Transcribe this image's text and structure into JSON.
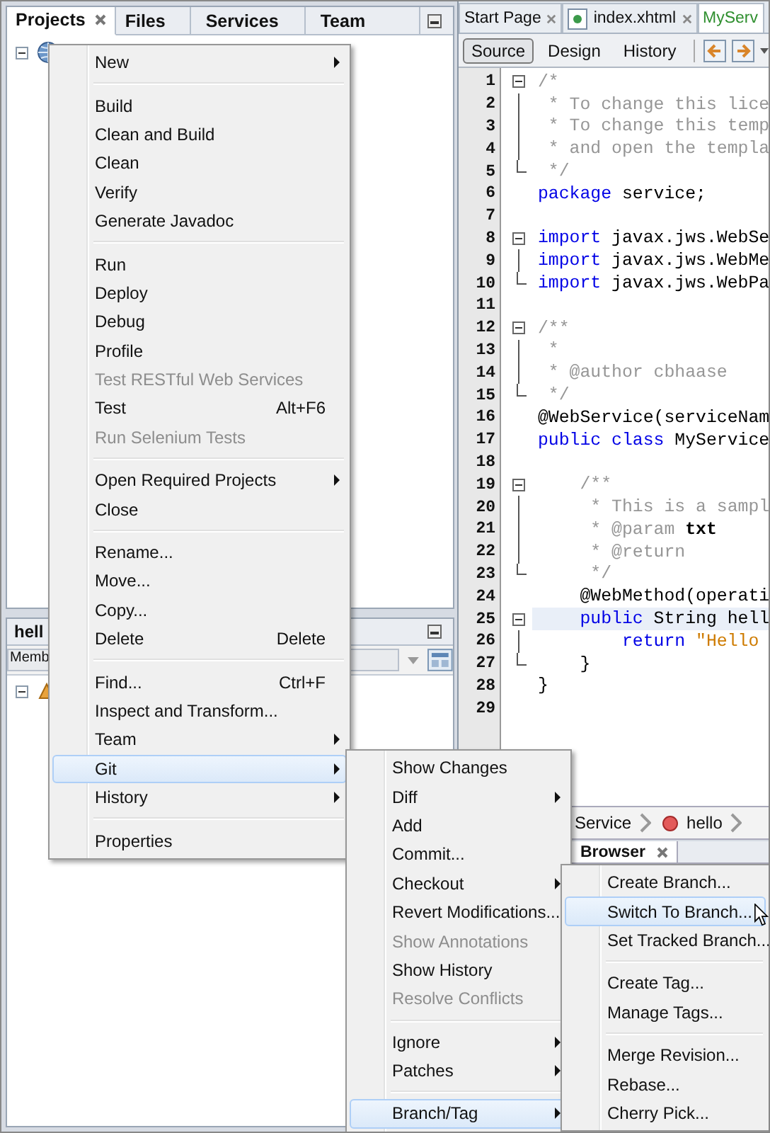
{
  "projects_panel": {
    "tabs": [
      {
        "label": "Projects",
        "selected": true,
        "closable": true
      },
      {
        "label": "Files",
        "selected": false,
        "closable": false
      },
      {
        "label": "Services",
        "selected": false,
        "closable": false
      },
      {
        "label": "Team",
        "selected": false,
        "closable": false
      }
    ],
    "tree_root": {
      "expanded": true
    }
  },
  "navigator_panel": {
    "title": "hell",
    "filter": "Memb",
    "tree_root": {
      "expanded": true
    }
  },
  "editor": {
    "tabs": [
      {
        "label": "Start Page",
        "selected": false,
        "has_icon": false
      },
      {
        "label": "index.xhtml",
        "selected": false,
        "has_icon": true
      },
      {
        "label": "MyServ",
        "selected": true,
        "has_icon": false
      }
    ],
    "views": [
      {
        "label": "Source",
        "selected": true
      },
      {
        "label": "Design",
        "selected": false
      },
      {
        "label": "History",
        "selected": false
      }
    ],
    "lines": [
      {
        "number": "1",
        "kind": "fold_start",
        "current": false,
        "tokens": [
          {
            "kind": "comment",
            "text": "/*"
          }
        ]
      },
      {
        "number": "2",
        "kind": "fold_body",
        "current": false,
        "tokens": [
          {
            "kind": "comment",
            "text": " * To change this lice"
          }
        ]
      },
      {
        "number": "3",
        "kind": "fold_body",
        "current": false,
        "tokens": [
          {
            "kind": "comment",
            "text": " * To change this temp"
          }
        ]
      },
      {
        "number": "4",
        "kind": "fold_body",
        "current": false,
        "tokens": [
          {
            "kind": "comment",
            "text": " * and open the templa"
          }
        ]
      },
      {
        "number": "5",
        "kind": "fold_end",
        "current": false,
        "tokens": [
          {
            "kind": "comment",
            "text": " */"
          }
        ]
      },
      {
        "number": "6",
        "kind": "plain",
        "current": false,
        "tokens": [
          {
            "kind": "keyword",
            "text": "package"
          },
          {
            "kind": "plain",
            "text": " service;"
          }
        ]
      },
      {
        "number": "7",
        "kind": "plain",
        "current": false
      },
      {
        "number": "8",
        "kind": "fold_start",
        "current": false,
        "tokens": [
          {
            "kind": "keyword",
            "text": "import"
          },
          {
            "kind": "plain",
            "text": " javax.jws.WebSe"
          }
        ]
      },
      {
        "number": "9",
        "kind": "fold_body",
        "current": false,
        "tokens": [
          {
            "kind": "keyword",
            "text": "import"
          },
          {
            "kind": "plain",
            "text": " javax.jws.WebMe"
          }
        ]
      },
      {
        "number": "10",
        "kind": "fold_end",
        "current": false,
        "tokens": [
          {
            "kind": "keyword",
            "text": "import"
          },
          {
            "kind": "plain",
            "text": " javax.jws.WebPa"
          }
        ]
      },
      {
        "number": "11",
        "kind": "plain",
        "current": false
      },
      {
        "number": "12",
        "kind": "fold_start",
        "current": false,
        "tokens": [
          {
            "kind": "comment",
            "text": "/**"
          }
        ]
      },
      {
        "number": "13",
        "kind": "fold_body",
        "current": false,
        "tokens": [
          {
            "kind": "comment",
            "text": " *"
          }
        ]
      },
      {
        "number": "14",
        "kind": "fold_body",
        "current": false,
        "tokens": [
          {
            "kind": "comment",
            "text": " * @author cbhaase"
          }
        ]
      },
      {
        "number": "15",
        "kind": "fold_end",
        "current": false,
        "tokens": [
          {
            "kind": "comment",
            "text": " */"
          }
        ]
      },
      {
        "number": "16",
        "kind": "plain",
        "current": false,
        "tokens": [
          {
            "kind": "plain",
            "text": "@WebService(serviceNam"
          }
        ]
      },
      {
        "number": "17",
        "kind": "plain",
        "current": false,
        "tokens": [
          {
            "kind": "keyword",
            "text": "public class"
          },
          {
            "kind": "plain",
            "text": " MyService"
          }
        ]
      },
      {
        "number": "18",
        "kind": "plain",
        "current": false
      },
      {
        "number": "19",
        "kind": "fold_start",
        "current": false,
        "tokens": [
          {
            "kind": "comment",
            "text": "    /**"
          }
        ]
      },
      {
        "number": "20",
        "kind": "fold_body",
        "current": false,
        "tokens": [
          {
            "kind": "comment",
            "text": "     * This is a sampl"
          }
        ]
      },
      {
        "number": "21",
        "kind": "fold_body",
        "current": false,
        "tokens": [
          {
            "kind": "comment",
            "text": "     * @param "
          },
          {
            "kind": "param",
            "text": "txt"
          }
        ]
      },
      {
        "number": "22",
        "kind": "fold_body",
        "current": false,
        "tokens": [
          {
            "kind": "comment",
            "text": "     * @return"
          }
        ]
      },
      {
        "number": "23",
        "kind": "fold_end",
        "current": false,
        "tokens": [
          {
            "kind": "comment",
            "text": "     */"
          }
        ]
      },
      {
        "number": "24",
        "kind": "plain",
        "current": false,
        "tokens": [
          {
            "kind": "plain",
            "text": "    @WebMethod(operati"
          }
        ]
      },
      {
        "number": "25",
        "kind": "fold_start",
        "current": true,
        "tokens": [
          {
            "kind": "keyword",
            "text": "    public"
          },
          {
            "kind": "plain",
            "text": " String hell"
          }
        ]
      },
      {
        "number": "26",
        "kind": "fold_body",
        "current": false,
        "tokens": [
          {
            "kind": "keyword",
            "text": "        return"
          },
          {
            "kind": "string",
            "text": " \"Hello"
          }
        ]
      },
      {
        "number": "27",
        "kind": "fold_end",
        "current": false,
        "tokens": [
          {
            "kind": "plain",
            "text": "    }"
          }
        ]
      },
      {
        "number": "28",
        "kind": "plain",
        "current": false,
        "tokens": [
          {
            "kind": "plain",
            "text": "}"
          }
        ]
      },
      {
        "number": "29",
        "kind": "plain",
        "current": false
      }
    ]
  },
  "breadcrumbs": [
    {
      "label": "Service",
      "has_icon": false
    },
    {
      "label": "hello",
      "has_icon": true
    }
  ],
  "browser_panel": {
    "tabs": [
      {
        "label": "Browser",
        "selected": true
      }
    ]
  },
  "context_menu": [
    {
      "kind": "item",
      "label": "New",
      "submenu": true,
      "disabled": false,
      "selected": false
    },
    {
      "kind": "separator"
    },
    {
      "kind": "item",
      "label": "Build",
      "submenu": false,
      "disabled": false,
      "selected": false
    },
    {
      "kind": "item",
      "label": "Clean and Build",
      "submenu": false,
      "disabled": false,
      "selected": false
    },
    {
      "kind": "item",
      "label": "Clean",
      "submenu": false,
      "disabled": false,
      "selected": false
    },
    {
      "kind": "item",
      "label": "Verify",
      "submenu": false,
      "disabled": false,
      "selected": false
    },
    {
      "kind": "item",
      "label": "Generate Javadoc",
      "submenu": false,
      "disabled": false,
      "selected": false
    },
    {
      "kind": "separator"
    },
    {
      "kind": "item",
      "label": "Run",
      "submenu": false,
      "disabled": false,
      "selected": false
    },
    {
      "kind": "item",
      "label": "Deploy",
      "submenu": false,
      "disabled": false,
      "selected": false
    },
    {
      "kind": "item",
      "label": "Debug",
      "submenu": false,
      "disabled": false,
      "selected": false
    },
    {
      "kind": "item",
      "label": "Profile",
      "submenu": false,
      "disabled": false,
      "selected": false
    },
    {
      "kind": "item",
      "label": "Test RESTful Web Services",
      "submenu": false,
      "disabled": true,
      "selected": false
    },
    {
      "kind": "item",
      "label": "Test",
      "shortcut": "Alt+F6",
      "submenu": false,
      "disabled": false,
      "selected": false
    },
    {
      "kind": "item",
      "label": "Run Selenium Tests",
      "submenu": false,
      "disabled": true,
      "selected": false
    },
    {
      "kind": "separator"
    },
    {
      "kind": "item",
      "label": "Open Required Projects",
      "submenu": true,
      "disabled": false,
      "selected": false
    },
    {
      "kind": "item",
      "label": "Close",
      "submenu": false,
      "disabled": false,
      "selected": false
    },
    {
      "kind": "separator"
    },
    {
      "kind": "item",
      "label": "Rename...",
      "submenu": false,
      "disabled": false,
      "selected": false
    },
    {
      "kind": "item",
      "label": "Move...",
      "submenu": false,
      "disabled": false,
      "selected": false
    },
    {
      "kind": "item",
      "label": "Copy...",
      "submenu": false,
      "disabled": false,
      "selected": false
    },
    {
      "kind": "item",
      "label": "Delete",
      "shortcut": "Delete",
      "submenu": false,
      "disabled": false,
      "selected": false
    },
    {
      "kind": "separator"
    },
    {
      "kind": "item",
      "label": "Find...",
      "shortcut": "Ctrl+F",
      "submenu": false,
      "disabled": false,
      "selected": false
    },
    {
      "kind": "item",
      "label": "Inspect and Transform...",
      "submenu": false,
      "disabled": false,
      "selected": false
    },
    {
      "kind": "item",
      "label": "Team",
      "submenu": true,
      "disabled": false,
      "selected": false
    },
    {
      "kind": "item",
      "label": "Git",
      "submenu": true,
      "disabled": false,
      "selected": true
    },
    {
      "kind": "item",
      "label": "History",
      "submenu": true,
      "disabled": false,
      "selected": false
    },
    {
      "kind": "separator"
    },
    {
      "kind": "item",
      "label": "Properties",
      "submenu": false,
      "disabled": false,
      "selected": false
    }
  ],
  "git_submenu": [
    {
      "kind": "item",
      "label": "Show Changes",
      "submenu": false,
      "disabled": false,
      "selected": false
    },
    {
      "kind": "item",
      "label": "Diff",
      "submenu": true,
      "disabled": false,
      "selected": false
    },
    {
      "kind": "item",
      "label": "Add",
      "submenu": false,
      "disabled": false,
      "selected": false
    },
    {
      "kind": "item",
      "label": "Commit...",
      "submenu": false,
      "disabled": false,
      "selected": false
    },
    {
      "kind": "item",
      "label": "Checkout",
      "submenu": true,
      "disabled": false,
      "selected": false
    },
    {
      "kind": "item",
      "label": "Revert Modifications...",
      "submenu": false,
      "disabled": false,
      "selected": false
    },
    {
      "kind": "item",
      "label": "Show Annotations",
      "submenu": false,
      "disabled": true,
      "selected": false
    },
    {
      "kind": "item",
      "label": "Show History",
      "submenu": false,
      "disabled": false,
      "selected": false
    },
    {
      "kind": "item",
      "label": "Resolve Conflicts",
      "submenu": false,
      "disabled": true,
      "selected": false
    },
    {
      "kind": "separator"
    },
    {
      "kind": "item",
      "label": "Ignore",
      "submenu": true,
      "disabled": false,
      "selected": false
    },
    {
      "kind": "item",
      "label": "Patches",
      "submenu": true,
      "disabled": false,
      "selected": false
    },
    {
      "kind": "separator"
    },
    {
      "kind": "item",
      "label": "Branch/Tag",
      "submenu": true,
      "disabled": false,
      "selected": true
    }
  ],
  "branch_tag_submenu": [
    {
      "kind": "item",
      "label": "Create Branch...",
      "submenu": false,
      "disabled": false,
      "selected": false
    },
    {
      "kind": "item",
      "label": "Switch To Branch...",
      "submenu": false,
      "disabled": false,
      "selected": true
    },
    {
      "kind": "item",
      "label": "Set Tracked Branch...",
      "submenu": false,
      "disabled": false,
      "selected": false
    },
    {
      "kind": "separator"
    },
    {
      "kind": "item",
      "label": "Create Tag...",
      "submenu": false,
      "disabled": false,
      "selected": false
    },
    {
      "kind": "item",
      "label": "Manage Tags...",
      "submenu": false,
      "disabled": false,
      "selected": false
    },
    {
      "kind": "separator"
    },
    {
      "kind": "item",
      "label": "Merge Revision...",
      "submenu": false,
      "disabled": false,
      "selected": false
    },
    {
      "kind": "item",
      "label": "Rebase...",
      "submenu": false,
      "disabled": false,
      "selected": false
    },
    {
      "kind": "item",
      "label": "Cherry Pick...",
      "submenu": false,
      "disabled": false,
      "selected": false
    }
  ]
}
